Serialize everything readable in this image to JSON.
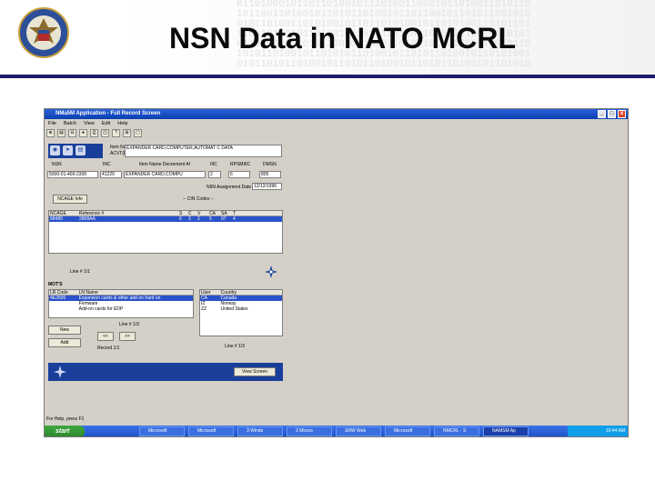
{
  "slide": {
    "title": "NSN Data in NATO MCRL",
    "header_pattern": [
      "0110100010110110100101110100110001011010011010110",
      "1011001101001011010110100101101100101101011001010",
      "0101101001101010010110110101001011010100110101101",
      "1100101101011010010110101101001101011010010110101",
      "0110100101101011001011010110100101101001011010110",
      "1010110100101101010110100101101011010010110101001",
      "0101101011010010110101101001011010110100101101010"
    ]
  },
  "app": {
    "title": "NMa5M Application - Full Record Screen",
    "window_buttons": [
      "_",
      "□",
      "x"
    ],
    "menu": [
      "File",
      "Batch",
      "View",
      "Edit",
      "Help"
    ],
    "toolbar": [
      "⊕",
      "▤",
      "⊟",
      "●",
      "⎙",
      "◫",
      "?",
      "⊞",
      "▢"
    ]
  },
  "record": {
    "item_name_label": "Item Name",
    "acvt_label": "ACVT(FI)",
    "item_name_value": "EXPANDER CARD,COMPUTER,AUTOMAT C DATA",
    "headers": [
      "NSN",
      "INC",
      "Item Name Decrement AI",
      "IIIC",
      "RPSMIIIC",
      "DMSN"
    ],
    "values": [
      "5000-01-400-2300",
      "41220",
      "EXPANDER CARD,COMPU",
      "2",
      "6",
      "805"
    ],
    "assignment_label": "NIIN Assignment Date",
    "assignment_value": "12/12/1996",
    "cage_button": "NCAGE Info",
    "cin_label": "-- CIN Codes --"
  },
  "refs": {
    "headers": [
      "NCAGE",
      "Reference #",
      "S",
      "C",
      "V",
      "CA",
      "SA",
      "T"
    ],
    "rows": [
      [
        "68480",
        "2808AA",
        "6",
        "3",
        "2",
        "5",
        "07",
        "4"
      ]
    ],
    "line_text": "Line # 1/1"
  },
  "mots": {
    "section_label": "MOT'S",
    "headers": [
      "LR Code",
      "LN Name"
    ],
    "rows": [
      [
        "4E2500",
        "Expansion cards & other add-on hard on"
      ],
      [
        "",
        "Firmware"
      ],
      [
        "",
        "Add-on cards for EDP"
      ]
    ],
    "new_button": "New",
    "add_button": "Add",
    "line_text": "Line # 1/3",
    "record_text": "Record 1/1",
    "prev_button": "<<",
    "next_button": ">>"
  },
  "users": {
    "headers": [
      "User",
      "Country"
    ],
    "rows": [
      [
        "CA",
        "Canada"
      ],
      [
        "IZ",
        "Norway"
      ],
      [
        "ZZ",
        "United States"
      ]
    ],
    "line_text": "Line # 1/3"
  },
  "bottom": {
    "view_button": "View Screen"
  },
  "statusbar": {
    "help_text": "For Help, press F1"
  },
  "taskbar": {
    "start_label": "start",
    "tasks": [
      "Microsoft",
      "Microsoft",
      "3 Windo",
      "2 Micros",
      "SRW Web",
      "Microsoft",
      "NMCRL - S",
      "NAMSM Ap"
    ],
    "clock": "10:44 AM"
  },
  "colors": {
    "header_rule": "#1d1d6b",
    "window_bg": "#d4d0c8",
    "titlebar": "#0b3fb0",
    "selection": "#2a52c9",
    "panel_blue": "#1a3f9b",
    "taskbar": "#1e51c8",
    "start_green": "#2c872c"
  }
}
